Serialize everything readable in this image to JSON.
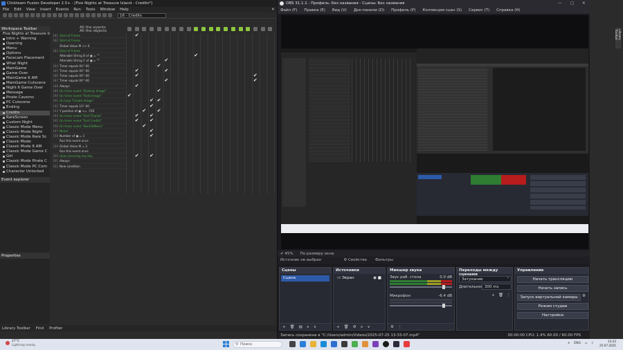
{
  "ctf": {
    "title": "Clickteam Fusion Developer 2.5+ - [Five Nights at Treasure Island - Credits*]",
    "menu": [
      "File",
      "Edit",
      "View",
      "Insert",
      "Events",
      "Run",
      "Tools",
      "Window",
      "Help"
    ],
    "frame_select": "16 - Credits",
    "close_glyph": "✕",
    "workspace_header": "Workspace Toolbar",
    "tree_root": "Five Nights at Treasure Is",
    "tree_items": [
      "Intro + Warning",
      "Opening",
      "Menu",
      "Options",
      "Facecam Placement",
      "What Night",
      "MainGame",
      "Game Over",
      "MainGame 6 AM",
      "MainGame Cutscene",
      "Night 6 Game Over",
      "Message",
      "Pirate Caverns",
      "PC Cutscene",
      "Ending",
      "Credits",
      "RareScreen",
      "Custom Night",
      "Classic Mode Menu",
      "Classic Mode Night",
      "Classic Mode Rare Sc",
      "Classic Mode",
      "Classic Mode 6 AM",
      "Classic Mode Game C",
      "Girl",
      "Classic Mode Pirate C",
      "Classic Mode PC Com",
      "Character Unlocked"
    ],
    "selected_tree_index": 15,
    "event_explorer_header": "Event explorer",
    "properties_header": "Properties",
    "bottom_tabs": [
      "Library Toolbar",
      "Find",
      "Profiler"
    ],
    "events_header": [
      "All the events",
      "All the objects"
    ],
    "events": [
      {
        "num": "181",
        "text": "Start of Frame",
        "green": true
      },
      {
        "num": "182",
        "text": "Start of Frame",
        "green": true
      },
      {
        "num": "",
        "text": "Global Value M <> 0",
        "green": false
      },
      {
        "num": "183",
        "text": "Start of Frame",
        "green": true
      },
      {
        "num": "",
        "text": "Alterable String B of ▣ = \"\"",
        "green": false
      },
      {
        "num": "",
        "text": "Alterable String C of ▣ = \"\"",
        "green": false
      },
      {
        "num": "184",
        "text": "Timer equals 00''-00",
        "green": false
      },
      {
        "num": "185",
        "text": "Timer equals 00''-00",
        "green": false
      },
      {
        "num": "186",
        "text": "Timer equals 00''-00",
        "green": false
      },
      {
        "num": "187",
        "text": "Timer equals 00''-00",
        "green": false
      },
      {
        "num": "188",
        "text": "Always",
        "green": false
      },
      {
        "num": "189",
        "text": "On timer event \"Destroy Image\"",
        "green": true
      },
      {
        "num": "190",
        "text": "On timer event \"Hold Image\"",
        "green": true
      },
      {
        "num": "191",
        "text": "On loop \"Create Image\"",
        "green": true
      },
      {
        "num": "192",
        "text": "Timer equals 10''-00",
        "green": false
      },
      {
        "num": "193",
        "text": "Y position of ▣ <= -720",
        "green": false
      },
      {
        "num": "194",
        "text": "On timer event \"End Thanks\"",
        "green": true
      },
      {
        "num": "195",
        "text": "On timer event \"End Credits\"",
        "green": true
      },
      {
        "num": "196",
        "text": "On timer event \"BackToMenu\"",
        "green": true
      },
      {
        "num": "197",
        "text": "Never",
        "green": true
      },
      {
        "num": "198",
        "text": "Number of ▣ = 1",
        "green": false
      },
      {
        "num": "",
        "text": "Run this event once",
        "green": false
      },
      {
        "num": "199",
        "text": "Global Value M = 3",
        "green": false
      },
      {
        "num": "",
        "text": "Run this event once",
        "green": false
      },
      {
        "num": "200",
        "text": "Upon pressing any key",
        "green": true
      },
      {
        "num": "201",
        "text": "Always",
        "green": false
      },
      {
        "num": "202",
        "text": "New condition",
        "green": false
      }
    ],
    "check_glyph": "✔"
  },
  "obs": {
    "title": "OBS 31.1.1 - Профиль: Без названия - Сцены: Без названия",
    "menu": [
      "Файл (F)",
      "Правка (E)",
      "Вид (V)",
      "Док-панели (D)",
      "Профиль (P)",
      "Коллекция сцен (S)",
      "Сервис (T)",
      "Справка (H)"
    ],
    "src_bar": [
      "✔ 45%",
      "По размеру окна"
    ],
    "no_source": "Источник не выбран",
    "props_btn": "⚙ Свойства",
    "filters_btn": "Фильтры",
    "docks": {
      "scenes": {
        "title": "Сцены",
        "item": "Сцена"
      },
      "sources": {
        "title": "Источники",
        "item": "Экран"
      },
      "mixer": {
        "title": "Микшер звука",
        "ch1": "Звук раб. стола",
        "ch1_db": "0.0 dB",
        "ch2": "Микрофон",
        "ch2_db": "-6.4 dB"
      },
      "transitions": {
        "title": "Переходы между сценами",
        "type": "Затухание",
        "duration_label": "Длительность",
        "duration": "300 ms"
      },
      "controls": {
        "title": "Управление",
        "buttons": [
          "Начать трансляцию",
          "Начать запись",
          "Запуск виртуальной камеры",
          "Режим студии",
          "Настройки"
        ]
      }
    },
    "status_left": "Запись сохранена в \"C:/Users/admin/Videos/2025-07-25 13-33-07.mp4\"",
    "status_right": "00:00:00   CPU: 1.4%   60.00 / 60.00 FPS",
    "rec_time": "00:00:00"
  },
  "right_strip": {
    "tab": "Library Toolbar"
  },
  "taskbar": {
    "temp": "27°C",
    "condition": "Lightning nearby",
    "search": "Поиск",
    "lang": "ENG",
    "time": "13:33",
    "date": "25.07.2025"
  },
  "colors": {
    "accent_blue": "#2d5aa8",
    "event_green": "#4fb34f",
    "record_red": "#b71c1c"
  }
}
